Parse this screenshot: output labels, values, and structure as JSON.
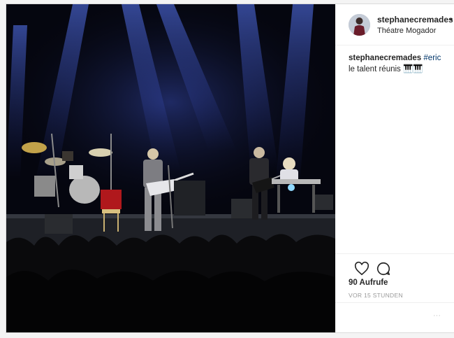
{
  "post": {
    "username": "stephanecremades",
    "dot": "•",
    "location": "Théatre Mogador",
    "caption_user": "stephanecremades",
    "hashtag": "#eric",
    "caption_text": "le talent réunis 🎹🎹",
    "views": "90 Aufrufe",
    "time": "VOR 15 STUNDEN",
    "more": "···"
  },
  "icons": {
    "like": "heart-icon",
    "comment": "comment-icon",
    "more": "more-options-icon"
  },
  "colors": {
    "hashtag": "#003569",
    "stage_light": "#6c8cff",
    "background": "#05060f"
  }
}
